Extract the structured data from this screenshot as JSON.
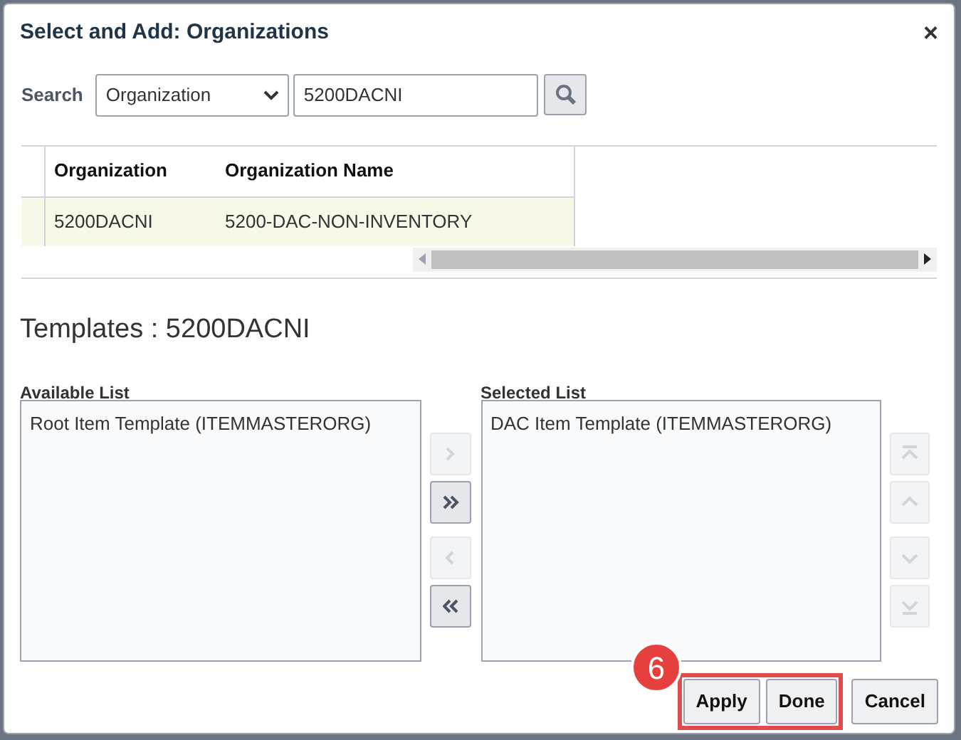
{
  "dialog": {
    "title": "Select and Add: Organizations",
    "close": "×"
  },
  "search": {
    "label": "Search",
    "field": "Organization",
    "value": "5200DACNI"
  },
  "table": {
    "columns": [
      "Organization",
      "Organization Name"
    ],
    "rows": [
      {
        "cells": [
          "5200DACNI",
          "5200-DAC-NON-INVENTORY"
        ],
        "selected": true
      }
    ]
  },
  "templates_heading": "Templates : 5200DACNI",
  "available": {
    "label": "Available List",
    "items": [
      "Root Item Template (ITEMMASTERORG)"
    ]
  },
  "selected_list": {
    "label": "Selected List",
    "items": [
      "DAC Item Template (ITEMMASTERORG)"
    ]
  },
  "shuttle_buttons": [
    {
      "kind": "move",
      "disabled": true
    },
    {
      "kind": "move_all",
      "disabled": false
    },
    {
      "kind": "remove",
      "disabled": true
    },
    {
      "kind": "remove_all",
      "disabled": false
    }
  ],
  "reorder_buttons": [
    {
      "kind": "top",
      "disabled": true
    },
    {
      "kind": "up",
      "disabled": true
    },
    {
      "kind": "down",
      "disabled": true
    },
    {
      "kind": "bottom",
      "disabled": true
    }
  ],
  "step_badge": "6",
  "buttons": [
    {
      "label": "Apply",
      "highlighted": true
    },
    {
      "label": "Done",
      "highlighted": true
    },
    {
      "label": "Cancel",
      "highlighted": false
    }
  ]
}
